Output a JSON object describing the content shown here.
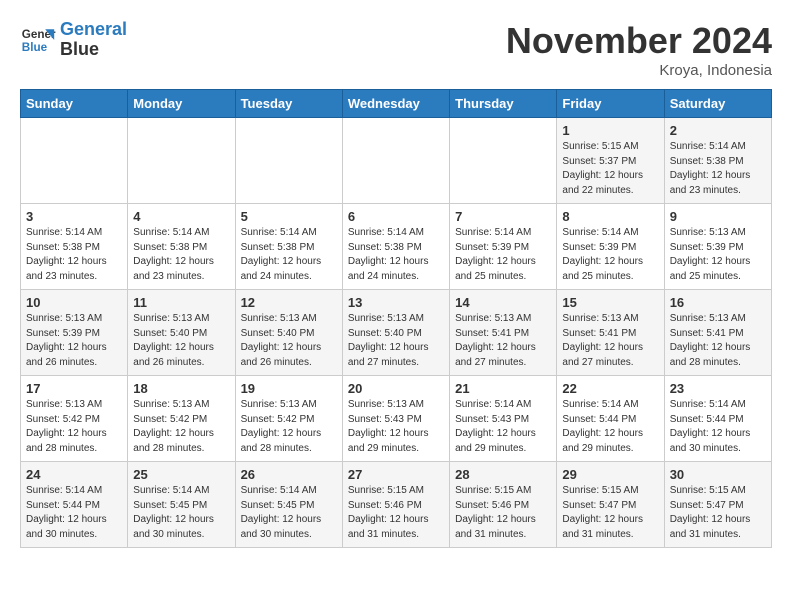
{
  "header": {
    "logo_line1": "General",
    "logo_line2": "Blue",
    "month": "November 2024",
    "location": "Kroya, Indonesia"
  },
  "weekdays": [
    "Sunday",
    "Monday",
    "Tuesday",
    "Wednesday",
    "Thursday",
    "Friday",
    "Saturday"
  ],
  "weeks": [
    [
      {
        "day": "",
        "info": ""
      },
      {
        "day": "",
        "info": ""
      },
      {
        "day": "",
        "info": ""
      },
      {
        "day": "",
        "info": ""
      },
      {
        "day": "",
        "info": ""
      },
      {
        "day": "1",
        "info": "Sunrise: 5:15 AM\nSunset: 5:37 PM\nDaylight: 12 hours\nand 22 minutes."
      },
      {
        "day": "2",
        "info": "Sunrise: 5:14 AM\nSunset: 5:38 PM\nDaylight: 12 hours\nand 23 minutes."
      }
    ],
    [
      {
        "day": "3",
        "info": "Sunrise: 5:14 AM\nSunset: 5:38 PM\nDaylight: 12 hours\nand 23 minutes."
      },
      {
        "day": "4",
        "info": "Sunrise: 5:14 AM\nSunset: 5:38 PM\nDaylight: 12 hours\nand 23 minutes."
      },
      {
        "day": "5",
        "info": "Sunrise: 5:14 AM\nSunset: 5:38 PM\nDaylight: 12 hours\nand 24 minutes."
      },
      {
        "day": "6",
        "info": "Sunrise: 5:14 AM\nSunset: 5:38 PM\nDaylight: 12 hours\nand 24 minutes."
      },
      {
        "day": "7",
        "info": "Sunrise: 5:14 AM\nSunset: 5:39 PM\nDaylight: 12 hours\nand 25 minutes."
      },
      {
        "day": "8",
        "info": "Sunrise: 5:14 AM\nSunset: 5:39 PM\nDaylight: 12 hours\nand 25 minutes."
      },
      {
        "day": "9",
        "info": "Sunrise: 5:13 AM\nSunset: 5:39 PM\nDaylight: 12 hours\nand 25 minutes."
      }
    ],
    [
      {
        "day": "10",
        "info": "Sunrise: 5:13 AM\nSunset: 5:39 PM\nDaylight: 12 hours\nand 26 minutes."
      },
      {
        "day": "11",
        "info": "Sunrise: 5:13 AM\nSunset: 5:40 PM\nDaylight: 12 hours\nand 26 minutes."
      },
      {
        "day": "12",
        "info": "Sunrise: 5:13 AM\nSunset: 5:40 PM\nDaylight: 12 hours\nand 26 minutes."
      },
      {
        "day": "13",
        "info": "Sunrise: 5:13 AM\nSunset: 5:40 PM\nDaylight: 12 hours\nand 27 minutes."
      },
      {
        "day": "14",
        "info": "Sunrise: 5:13 AM\nSunset: 5:41 PM\nDaylight: 12 hours\nand 27 minutes."
      },
      {
        "day": "15",
        "info": "Sunrise: 5:13 AM\nSunset: 5:41 PM\nDaylight: 12 hours\nand 27 minutes."
      },
      {
        "day": "16",
        "info": "Sunrise: 5:13 AM\nSunset: 5:41 PM\nDaylight: 12 hours\nand 28 minutes."
      }
    ],
    [
      {
        "day": "17",
        "info": "Sunrise: 5:13 AM\nSunset: 5:42 PM\nDaylight: 12 hours\nand 28 minutes."
      },
      {
        "day": "18",
        "info": "Sunrise: 5:13 AM\nSunset: 5:42 PM\nDaylight: 12 hours\nand 28 minutes."
      },
      {
        "day": "19",
        "info": "Sunrise: 5:13 AM\nSunset: 5:42 PM\nDaylight: 12 hours\nand 28 minutes."
      },
      {
        "day": "20",
        "info": "Sunrise: 5:13 AM\nSunset: 5:43 PM\nDaylight: 12 hours\nand 29 minutes."
      },
      {
        "day": "21",
        "info": "Sunrise: 5:14 AM\nSunset: 5:43 PM\nDaylight: 12 hours\nand 29 minutes."
      },
      {
        "day": "22",
        "info": "Sunrise: 5:14 AM\nSunset: 5:44 PM\nDaylight: 12 hours\nand 29 minutes."
      },
      {
        "day": "23",
        "info": "Sunrise: 5:14 AM\nSunset: 5:44 PM\nDaylight: 12 hours\nand 30 minutes."
      }
    ],
    [
      {
        "day": "24",
        "info": "Sunrise: 5:14 AM\nSunset: 5:44 PM\nDaylight: 12 hours\nand 30 minutes."
      },
      {
        "day": "25",
        "info": "Sunrise: 5:14 AM\nSunset: 5:45 PM\nDaylight: 12 hours\nand 30 minutes."
      },
      {
        "day": "26",
        "info": "Sunrise: 5:14 AM\nSunset: 5:45 PM\nDaylight: 12 hours\nand 30 minutes."
      },
      {
        "day": "27",
        "info": "Sunrise: 5:15 AM\nSunset: 5:46 PM\nDaylight: 12 hours\nand 31 minutes."
      },
      {
        "day": "28",
        "info": "Sunrise: 5:15 AM\nSunset: 5:46 PM\nDaylight: 12 hours\nand 31 minutes."
      },
      {
        "day": "29",
        "info": "Sunrise: 5:15 AM\nSunset: 5:47 PM\nDaylight: 12 hours\nand 31 minutes."
      },
      {
        "day": "30",
        "info": "Sunrise: 5:15 AM\nSunset: 5:47 PM\nDaylight: 12 hours\nand 31 minutes."
      }
    ]
  ]
}
